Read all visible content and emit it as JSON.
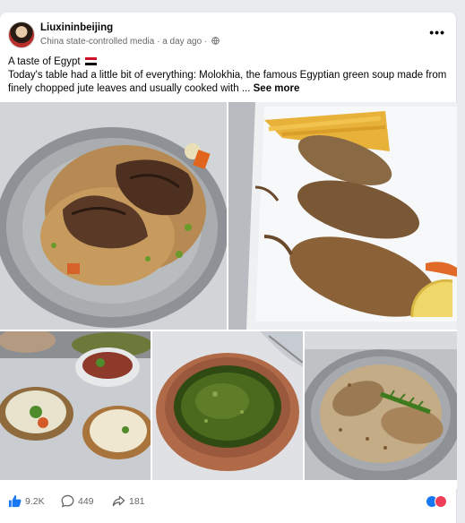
{
  "post": {
    "author": "Liuxininbeijing",
    "author_label": "China state-controlled media",
    "time": "a day ago",
    "separator": "·",
    "more_icon": "more-horizontal-icon",
    "title": "A taste of Egypt",
    "body_line1": "Today's table had a little bit of everything: Molokhia, the famous Egyptian green soup made from",
    "body_line2": "finely chopped jute leaves and usually cooked with ...",
    "see_more": "See more"
  },
  "photos": [
    {
      "name": "grilled-meat-pasta-platter"
    },
    {
      "name": "stuffed-pigeons-with-fries"
    },
    {
      "name": "dips-and-salad"
    },
    {
      "name": "molokhia-soup-bowl"
    },
    {
      "name": "rice-with-pigeon-platter"
    }
  ],
  "actions": {
    "likes": "9.2K",
    "comments": "449",
    "shares": "181"
  },
  "colors": {
    "accent": "#1877f2",
    "love": "#f33e58",
    "muted_text": "#65676b"
  }
}
